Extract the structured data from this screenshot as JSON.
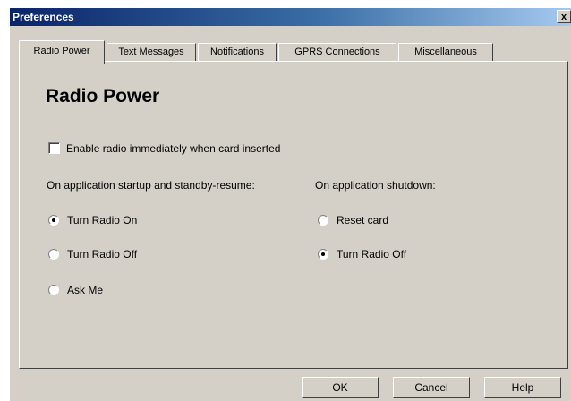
{
  "window": {
    "title": "Preferences",
    "close_glyph": "x"
  },
  "tabs": [
    {
      "label": "Radio Power",
      "active": true
    },
    {
      "label": "Text Messages",
      "active": false
    },
    {
      "label": "Notifications",
      "active": false
    },
    {
      "label": "GPRS Connections",
      "active": false
    },
    {
      "label": "Miscellaneous",
      "active": false
    }
  ],
  "panel": {
    "title": "Radio Power",
    "enable_checkbox": {
      "label": "Enable radio immediately when card inserted",
      "checked": false
    },
    "startup_group": {
      "label": "On application startup and standby-resume:",
      "options": [
        {
          "label": "Turn Radio On",
          "checked": true
        },
        {
          "label": "Turn Radio Off",
          "checked": false
        },
        {
          "label": "Ask Me",
          "checked": false
        }
      ]
    },
    "shutdown_group": {
      "label": "On application shutdown:",
      "options": [
        {
          "label": "Reset card",
          "checked": false
        },
        {
          "label": "Turn Radio Off",
          "checked": true
        }
      ]
    }
  },
  "buttons": {
    "ok": "OK",
    "cancel": "Cancel",
    "help": "Help"
  }
}
